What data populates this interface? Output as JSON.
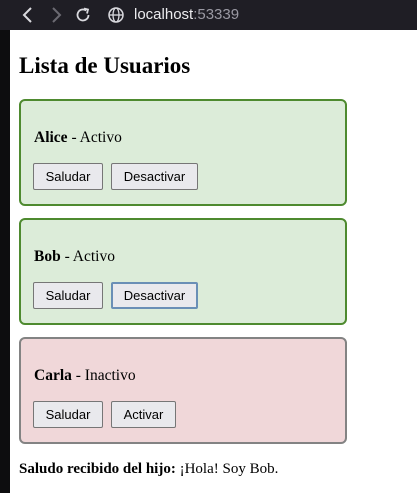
{
  "browser": {
    "url_host": "localhost",
    "url_port": ":53339"
  },
  "page": {
    "title": "Lista de Usuarios",
    "users": [
      {
        "name": "Alice",
        "status": " - Activo",
        "greet_label": "Saludar",
        "toggle_label": "Desactivar",
        "active": true
      },
      {
        "name": "Bob",
        "status": " - Activo",
        "greet_label": "Saludar",
        "toggle_label": "Desactivar",
        "active": true
      },
      {
        "name": "Carla",
        "status": " - Inactivo",
        "greet_label": "Saludar",
        "toggle_label": "Activar",
        "active": false
      }
    ],
    "child_message_label": "Saludo recibido del hijo:",
    "child_message_value": " ¡Hola! Soy Bob."
  },
  "colors": {
    "active_bg": "#dcecd9",
    "active_border": "#4e8a2f",
    "inactive_bg": "#f0d7d9",
    "inactive_border": "#838383",
    "toolbar_bg": "#1f1e25"
  }
}
